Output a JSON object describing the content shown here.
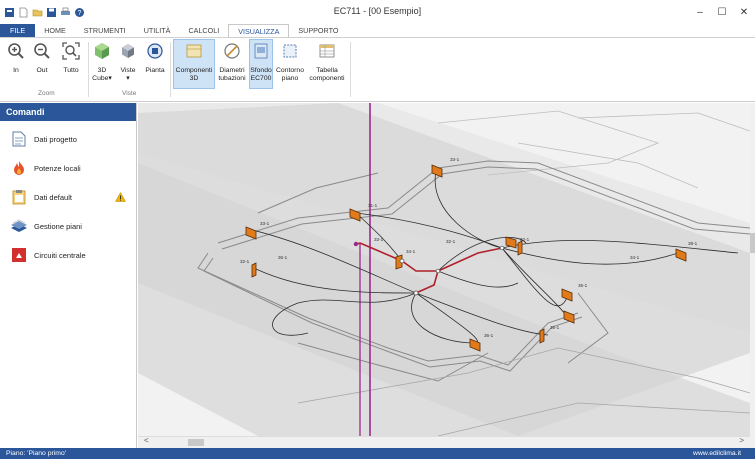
{
  "window": {
    "title": "EC711 - [00 Esempio]"
  },
  "ribbon": {
    "tabs": [
      "FILE",
      "HOME",
      "STRUMENTI",
      "UTILITÀ",
      "CALCOLI",
      "VISUALIZZA",
      "SUPPORTO"
    ],
    "active_tab": "VISUALIZZA",
    "zoom_group": {
      "label": "Zoom",
      "in": "In",
      "out": "Out",
      "all": "Tutto"
    },
    "viste_group": {
      "label": "Viste",
      "cube_line1": "3D",
      "cube_line2": "Cube",
      "viste": "Viste",
      "pianta": "Pianta"
    },
    "display": {
      "componenti_line1": "Componenti",
      "componenti_line2": "3D",
      "diametri_line1": "Diametri",
      "diametri_line2": "tubazioni",
      "sfondo_line1": "Sfondo",
      "sfondo_line2": "EC700",
      "contorno_line1": "Contorno",
      "contorno_line2": "piano",
      "tabella_line1": "Tabella",
      "tabella_line2": "componenti"
    },
    "dropdown_arrow": "▾"
  },
  "panel": {
    "title": "Comandi",
    "items": [
      {
        "label": "Dati progetto",
        "icon": "document-icon"
      },
      {
        "label": "Potenze locali",
        "icon": "flame-icon"
      },
      {
        "label": "Dati default",
        "icon": "clipboard-icon",
        "warning": true
      },
      {
        "label": "Gestione piani",
        "icon": "layers-icon"
      },
      {
        "label": "Circuiti centrale",
        "icon": "boiler-icon"
      }
    ]
  },
  "viewport": {
    "labels": [
      "33-1",
      "31-1",
      "33-1",
      "32-1",
      "34-1",
      "32-1",
      "34-1",
      "35-1",
      "36-1",
      "36-1",
      "36-1",
      "38-1",
      "33-1",
      "32-1"
    ],
    "scroll_left": "<",
    "scroll_right": ">"
  },
  "status": {
    "floor": "Piano: 'Piano primo'",
    "website": "www.edilclima.it"
  },
  "colors": {
    "accent": "#2b579a",
    "pipe_dark": "#222222",
    "pipe_red": "#b0202a",
    "riser": "#9b2a8e",
    "radiator": "#e07a1a"
  }
}
